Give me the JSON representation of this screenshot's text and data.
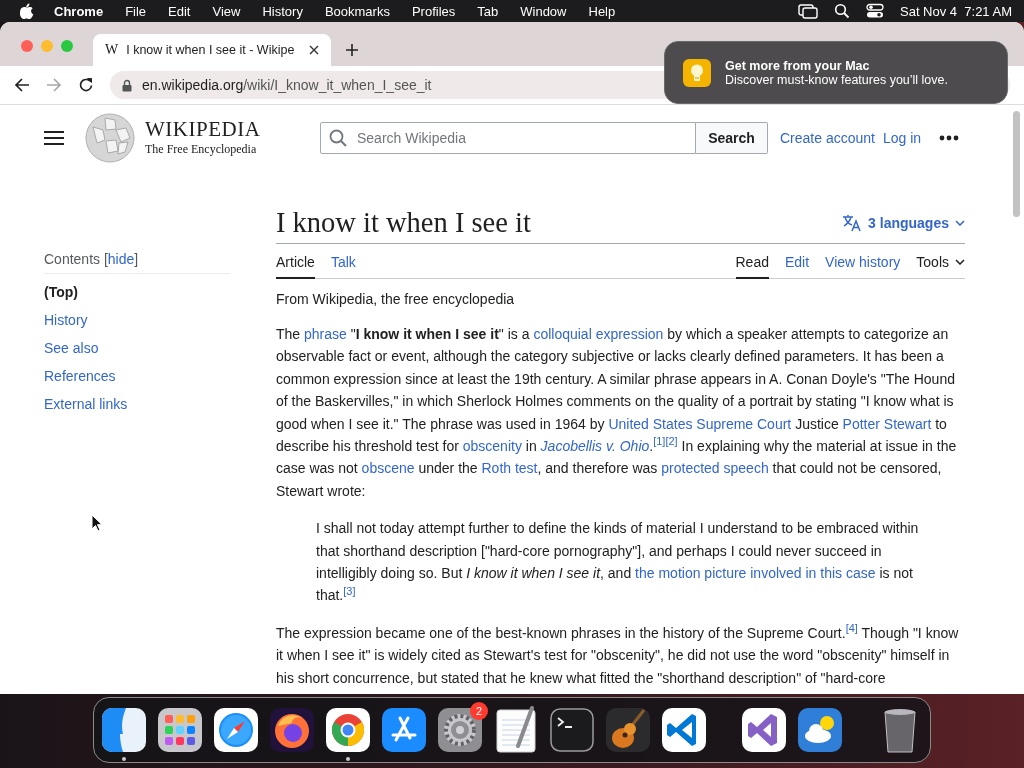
{
  "menu_bar": {
    "app": "Chrome",
    "menus": [
      "File",
      "Edit",
      "View",
      "History",
      "Bookmarks",
      "Profiles",
      "Tab",
      "Window",
      "Help"
    ],
    "clock": "Sat Nov 4  7:21 AM"
  },
  "browser": {
    "tabs": [
      {
        "favicon": "W",
        "title": "I know it when I see it - Wikipe",
        "selected": true
      }
    ],
    "back_disabled": false,
    "forward_disabled": true,
    "url_host": "en.wikipedia.org",
    "url_path": "/wiki/I_know_it_when_I_see_it"
  },
  "notification": {
    "title": "Get more from your Mac",
    "body": "Discover must-know features you’ll love."
  },
  "wiki": {
    "logo_title": "WIKIPEDIA",
    "logo_tagline": "The Free Encyclopedia",
    "search_placeholder": "Search Wikipedia",
    "search_button": "Search",
    "user_links": [
      "Create account",
      "Log in"
    ]
  },
  "toc": {
    "heading": [
      {
        "text": "Contents ",
        "kind": "plain"
      },
      {
        "text": "[",
        "kind": "plain"
      },
      {
        "text": "hide",
        "kind": "link"
      },
      {
        "text": "]",
        "kind": "plain"
      }
    ],
    "items": [
      {
        "label": "(Top)",
        "selected": true
      },
      {
        "label": "History",
        "selected": false
      },
      {
        "label": "See also",
        "selected": false
      },
      {
        "label": "References",
        "selected": false
      },
      {
        "label": "External links",
        "selected": false
      }
    ]
  },
  "article": {
    "title": "I know it when I see it",
    "languages": "3 languages",
    "tabs_left": [
      {
        "label": "Article",
        "selected": true
      },
      {
        "label": "Talk",
        "selected": false
      }
    ],
    "tabs_right": [
      {
        "label": "Read",
        "selected": true
      },
      {
        "label": "Edit",
        "selected": false
      },
      {
        "label": "View history",
        "selected": false
      }
    ],
    "tools": "Tools",
    "tagline": "From Wikipedia, the free encyclopedia",
    "blocks": [
      {
        "kind": "para",
        "segments": [
          {
            "text": "The ",
            "kind": "plain"
          },
          {
            "text": "phrase",
            "kind": "link"
          },
          {
            "text": " \"",
            "kind": "plain"
          },
          {
            "text": "I know it when I see it",
            "kind": "bold"
          },
          {
            "text": "\" is a ",
            "kind": "plain"
          },
          {
            "text": "colloquial expression",
            "kind": "link"
          },
          {
            "text": " by which a speaker attempts to categorize an observable fact or event, although the category subjective or lacks clearly defined parameters. It has been a common expression since at least the 19th century. A similar phrase appears in A. Conan Doyle's \"The Hound of the Baskervilles,\" in which Sherlock Holmes comments on the quality of a portrait by stating \"I know what is good when I see it.\" The phrase was used in 1964 by ",
            "kind": "plain"
          },
          {
            "text": "United States Supreme Court",
            "kind": "link"
          },
          {
            "text": " Justice ",
            "kind": "plain"
          },
          {
            "text": "Potter Stewart",
            "kind": "link"
          },
          {
            "text": " to describe his threshold test for ",
            "kind": "plain"
          },
          {
            "text": "obscenity",
            "kind": "link"
          },
          {
            "text": " in ",
            "kind": "plain"
          },
          {
            "text": "Jacobellis v. Ohio",
            "kind": "italic_link"
          },
          {
            "text": ".",
            "kind": "plain"
          },
          {
            "text": "[1][2]",
            "kind": "ref"
          },
          {
            "text": " In explaining why the material at issue in the case was not ",
            "kind": "plain"
          },
          {
            "text": "obscene",
            "kind": "link"
          },
          {
            "text": " under the ",
            "kind": "plain"
          },
          {
            "text": "Roth test",
            "kind": "link"
          },
          {
            "text": ", and therefore was ",
            "kind": "plain"
          },
          {
            "text": "protected speech",
            "kind": "link"
          },
          {
            "text": " that could not be censored, Stewart wrote:",
            "kind": "plain"
          }
        ]
      },
      {
        "kind": "quote",
        "segments": [
          {
            "text": "I shall not today attempt further to define the kinds of material I understand to be embraced within that shorthand description [\"hard-core pornography\"], and perhaps I could never succeed in intelligibly doing so. But ",
            "kind": "plain"
          },
          {
            "text": "I know it when I see it",
            "kind": "italic"
          },
          {
            "text": ", and ",
            "kind": "plain"
          },
          {
            "text": "the motion picture involved in this case",
            "kind": "link"
          },
          {
            "text": " is not that.",
            "kind": "plain"
          },
          {
            "text": "[3]",
            "kind": "ref"
          }
        ]
      },
      {
        "kind": "para",
        "segments": [
          {
            "text": "The expression became one of the best-known phrases in the history of the Supreme Court.",
            "kind": "plain"
          },
          {
            "text": "[4]",
            "kind": "ref"
          },
          {
            "text": " Though \"I know it when I see it\" is widely cited as Stewart's test for \"obscenity\", he did not use the word \"obscenity\" himself in his short concurrence, but stated that he knew what fitted the \"shorthand description\" of \"hard-core",
            "kind": "plain"
          }
        ]
      }
    ]
  },
  "dock": {
    "items": [
      {
        "kind": "finder",
        "running": true
      },
      {
        "kind": "launchpad",
        "running": false
      },
      {
        "kind": "safari",
        "running": false
      },
      {
        "kind": "firefox",
        "running": false
      },
      {
        "kind": "chrome",
        "running": true
      },
      {
        "kind": "appstore",
        "running": false
      },
      {
        "kind": "settings",
        "running": false,
        "badge": "2"
      },
      {
        "kind": "textedit",
        "running": false
      },
      {
        "kind": "terminal",
        "running": false
      },
      {
        "kind": "garageband",
        "running": false
      },
      {
        "kind": "vscode",
        "running": false
      },
      {
        "kind": "separator"
      },
      {
        "kind": "visualstudio",
        "running": false
      },
      {
        "kind": "weather",
        "running": false
      },
      {
        "kind": "separator"
      },
      {
        "kind": "trash",
        "running": false
      }
    ]
  }
}
